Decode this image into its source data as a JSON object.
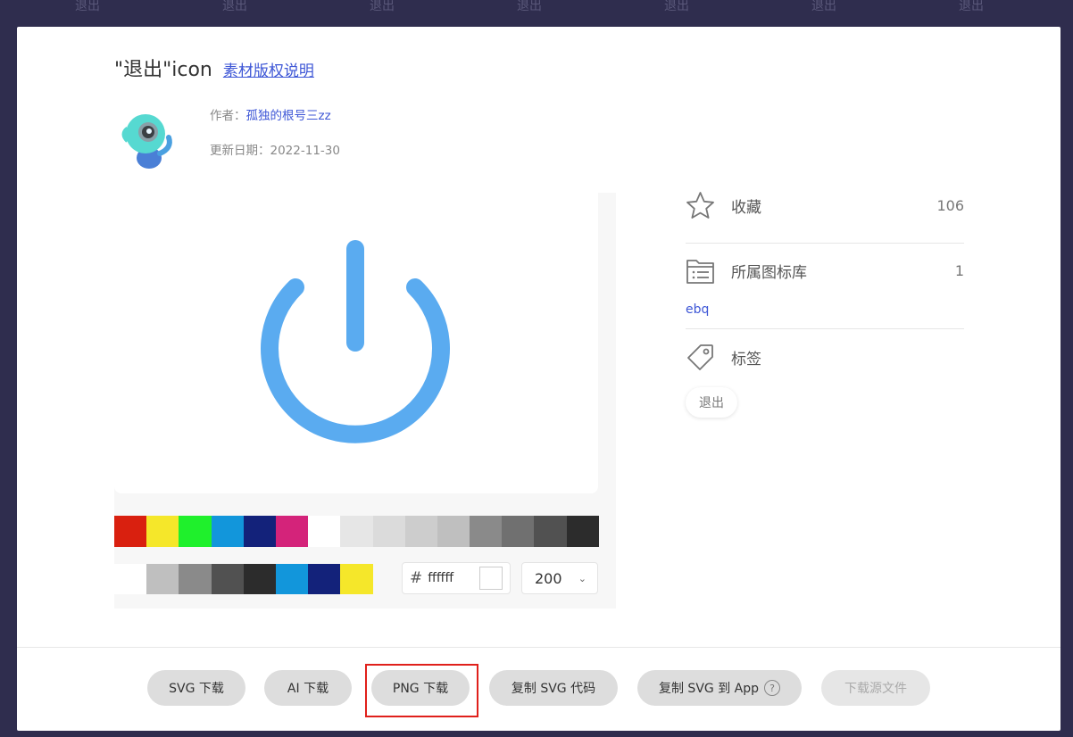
{
  "background": {
    "watermark_label": "退出"
  },
  "header": {
    "title": "\"退出\"icon",
    "copyright_link": "素材版权说明"
  },
  "author": {
    "author_label": "作者：",
    "author_name": "孤独的根号三zz",
    "updated_label": "更新日期：",
    "updated_date": "2022-11-30"
  },
  "preview": {
    "icon": "power-icon",
    "icon_color": "#5aabf0",
    "palette_row1": [
      "#d9200f",
      "#f5e72a",
      "#1ff02c",
      "#1296db",
      "#13227a",
      "#d4237a",
      "#ffffff",
      "#e6e6e6",
      "#dbdbdb",
      "#cdcdcd",
      "#bfbfbf",
      "#8a8a8a",
      "#707070",
      "#515151",
      "#2c2c2c"
    ],
    "palette_row2": [
      "#ffffff",
      "#bfbfbf",
      "#8a8a8a",
      "#515151",
      "#2c2c2c",
      "#1296db",
      "#13227a",
      "#f5e72a"
    ],
    "hex_prefix": "#",
    "hex_value": "ffffff",
    "size_value": "200"
  },
  "sidebar": {
    "favorite_label": "收藏",
    "favorite_count": "106",
    "library_label": "所属图标库",
    "library_count": "1",
    "library_name": "ebq",
    "tags_label": "标签",
    "tags": [
      "退出"
    ]
  },
  "footer": {
    "buttons": [
      {
        "label": "SVG 下载"
      },
      {
        "label": "AI 下载"
      },
      {
        "label": "PNG 下载"
      },
      {
        "label": "复制 SVG 代码"
      },
      {
        "label": "复制 SVG 到 App"
      },
      {
        "label": "下载源文件"
      }
    ],
    "help_glyph": "?"
  }
}
